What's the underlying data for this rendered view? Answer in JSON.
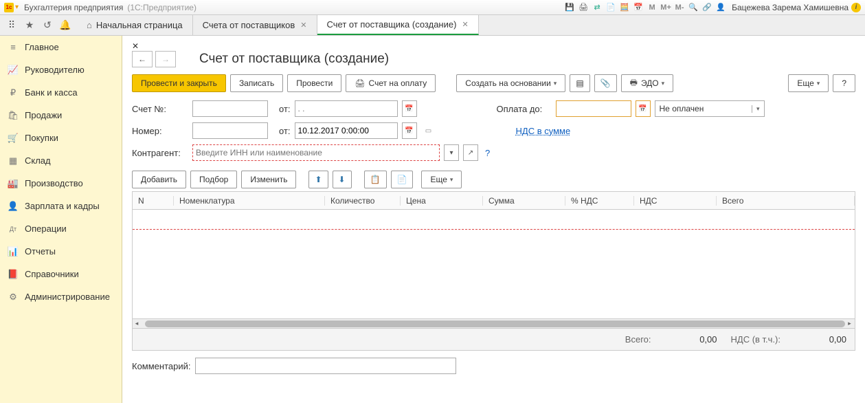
{
  "titlebar": {
    "app_title": "Бухгалтерия предприятия",
    "app_subtitle": "(1С:Предприятие)",
    "m": "M",
    "mplus": "M+",
    "mminus": "M-",
    "user": "Бацежева Зарема Хамишевна"
  },
  "tabs": {
    "home": "Начальная страница",
    "t1": "Счета от поставщиков",
    "t2": "Счет от поставщика (создание)"
  },
  "sidebar": {
    "items": [
      {
        "label": "Главное",
        "icon": "≡"
      },
      {
        "label": "Руководителю",
        "icon": "📈"
      },
      {
        "label": "Банк и касса",
        "icon": "₽"
      },
      {
        "label": "Продажи",
        "icon": "🛍"
      },
      {
        "label": "Покупки",
        "icon": "🛒"
      },
      {
        "label": "Склад",
        "icon": "▦"
      },
      {
        "label": "Производство",
        "icon": "🏭"
      },
      {
        "label": "Зарплата и кадры",
        "icon": "👤"
      },
      {
        "label": "Операции",
        "icon": "Дт"
      },
      {
        "label": "Отчеты",
        "icon": "📊"
      },
      {
        "label": "Справочники",
        "icon": "📕"
      },
      {
        "label": "Администрирование",
        "icon": "⚙"
      }
    ]
  },
  "page": {
    "title": "Счет от поставщика (создание)"
  },
  "toolbar": {
    "post_close": "Провести и закрыть",
    "save": "Записать",
    "post": "Провести",
    "invoice": "Счет на оплату",
    "create_based": "Создать на основании",
    "edo": "ЭДО",
    "more": "Еще",
    "help": "?"
  },
  "form": {
    "account_lbl": "Счет №:",
    "from_lbl": "от:",
    "date1_placeholder": ". .",
    "payment_until_lbl": "Оплата до:",
    "payment_date_placeholder": ". .",
    "status_value": "Не оплачен",
    "number_lbl": "Номер:",
    "date2_value": "10.12.2017 0:00:00",
    "vat_link": "НДС в сумме",
    "counterparty_lbl": "Контрагент:",
    "counterparty_placeholder": "Введите ИНН или наименование"
  },
  "table_toolbar": {
    "add": "Добавить",
    "pick": "Подбор",
    "edit": "Изменить",
    "more": "Еще"
  },
  "table": {
    "headers": {
      "n": "N",
      "nomenclature": "Номенклатура",
      "qty": "Количество",
      "price": "Цена",
      "sum": "Сумма",
      "vat_pct": "% НДС",
      "vat": "НДС",
      "total": "Всего"
    }
  },
  "totals": {
    "total_lbl": "Всего:",
    "total_val": "0,00",
    "vat_lbl": "НДС (в т.ч.):",
    "vat_val": "0,00"
  },
  "comment_lbl": "Комментарий:"
}
